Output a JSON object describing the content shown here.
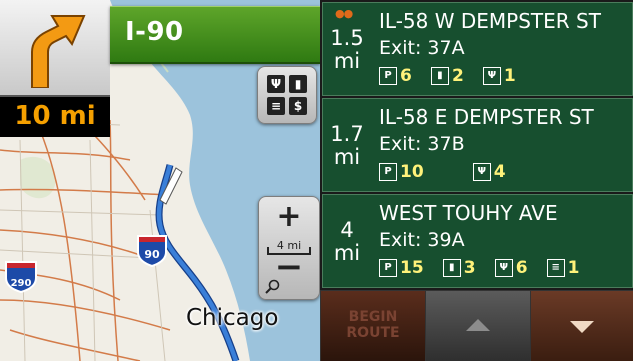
{
  "guidance": {
    "distance": "10 mi",
    "road_name": "I-90",
    "turn_icon": "turn-slight-right-arrow"
  },
  "map": {
    "city_label": "Chicago",
    "shields": [
      {
        "label": "90",
        "type": "interstate"
      },
      {
        "label": "290",
        "type": "interstate"
      }
    ],
    "scale_label": "4 mi",
    "colors": {
      "water": "#9cc3dc",
      "land": "#f1eee6",
      "route": "#3a7fd8"
    }
  },
  "controls": {
    "zoom_in": "+",
    "zoom_out": "−",
    "poi_filter_icons": [
      "food-icon",
      "gas-icon",
      "lodging-icon",
      "money-icon"
    ]
  },
  "exits": [
    {
      "distance_value": "1.5",
      "distance_unit": "mi",
      "road": "IL-58 W DEMPSTER ST",
      "exit": "Exit: 37A",
      "flagged": true,
      "amenities": [
        {
          "icon": "parking-icon",
          "count": "6"
        },
        {
          "icon": "gas-icon",
          "count": "2"
        },
        {
          "icon": "food-icon",
          "count": "1"
        }
      ]
    },
    {
      "distance_value": "1.7",
      "distance_unit": "mi",
      "road": "IL-58 E DEMPSTER ST",
      "exit": "Exit: 37B",
      "flagged": false,
      "amenities": [
        {
          "icon": "parking-icon",
          "count": "10"
        },
        {
          "icon": "food-icon",
          "count": "4"
        }
      ]
    },
    {
      "distance_value": "4",
      "distance_unit": "mi",
      "road": "WEST TOUHY AVE",
      "exit": "Exit: 39A",
      "flagged": false,
      "amenities": [
        {
          "icon": "parking-icon",
          "count": "15"
        },
        {
          "icon": "gas-icon",
          "count": "3"
        },
        {
          "icon": "food-icon",
          "count": "6"
        },
        {
          "icon": "lodging-icon",
          "count": "1"
        }
      ]
    }
  ],
  "bottom": {
    "begin_route_line1": "BEGIN",
    "begin_route_line2": "ROUTE"
  }
}
